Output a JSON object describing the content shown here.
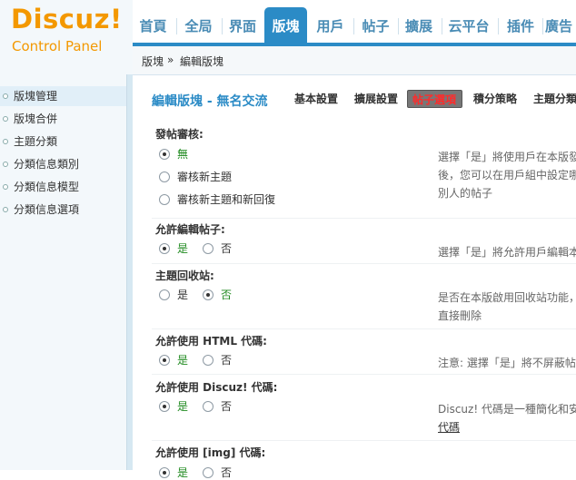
{
  "logo": {
    "main": "Discuz!",
    "sub": "Control Panel"
  },
  "nav": {
    "items": [
      {
        "label": "首頁",
        "active": false
      },
      {
        "label": "全局",
        "active": false
      },
      {
        "label": "界面",
        "active": false
      },
      {
        "label": "版塊",
        "active": true
      },
      {
        "label": "用戶",
        "active": false
      },
      {
        "label": "帖子",
        "active": false
      },
      {
        "label": "擴展",
        "active": false
      },
      {
        "label": "云平台",
        "active": false
      },
      {
        "label": "插件",
        "active": false
      },
      {
        "label": "廣告",
        "active": false
      }
    ]
  },
  "breadcrumb": {
    "root": "版塊",
    "sep": "»",
    "current": "編輯版塊"
  },
  "sidebar": {
    "items": [
      {
        "label": "版塊管理",
        "active": true
      },
      {
        "label": "版塊合併",
        "active": false
      },
      {
        "label": "主題分類",
        "active": false
      },
      {
        "label": "分類信息類別",
        "active": false
      },
      {
        "label": "分類信息模型",
        "active": false
      },
      {
        "label": "分類信息選項",
        "active": false
      }
    ]
  },
  "main": {
    "title": "編輯版塊 - 無名交流",
    "tabs": [
      {
        "label": "基本設置",
        "active": false
      },
      {
        "label": "擴展設置",
        "active": false
      },
      {
        "label": "帖子選項",
        "active": true
      },
      {
        "label": "積分策略",
        "active": false
      },
      {
        "label": "主題分類",
        "active": false
      }
    ],
    "sections": [
      {
        "title": "發帖審核:",
        "options": [
          {
            "label": "無",
            "checked": true
          },
          {
            "label": "審核新主題",
            "checked": false
          },
          {
            "label": "審核新主題和新回復",
            "checked": false
          }
        ],
        "desc": [
          "選擇「是」將使用戶在本版發",
          "後，您可以在用戶組中設定哪",
          "別人的帖子"
        ]
      },
      {
        "title": "允許編輯帖子:",
        "options": [
          {
            "label": "是",
            "checked": true
          },
          {
            "label": "否",
            "checked": false
          }
        ],
        "desc": [
          "選擇「是」將允許用戶編輯本"
        ]
      },
      {
        "title": "主題回收站:",
        "options": [
          {
            "label": "是",
            "checked": false
          },
          {
            "label": "否",
            "checked": true
          }
        ],
        "desc": [
          "是否在本版啟用回收站功能，",
          "直接刪除"
        ]
      },
      {
        "title": "允許使用 HTML 代碼:",
        "options": [
          {
            "label": "是",
            "checked": true
          },
          {
            "label": "否",
            "checked": false
          }
        ],
        "desc": [
          "注意: 選擇「是」將不屏蔽帖"
        ]
      },
      {
        "title": "允許使用 Discuz! 代碼:",
        "options": [
          {
            "label": "是",
            "checked": true
          },
          {
            "label": "否",
            "checked": false
          }
        ],
        "desc": [
          "Discuz! 代碼是一種簡化和安",
          "代碼"
        ]
      },
      {
        "title": "允許使用 [img] 代碼:",
        "options": [
          {
            "label": "是",
            "checked": true
          },
          {
            "label": "否",
            "checked": false
          }
        ],
        "desc": []
      }
    ]
  }
}
